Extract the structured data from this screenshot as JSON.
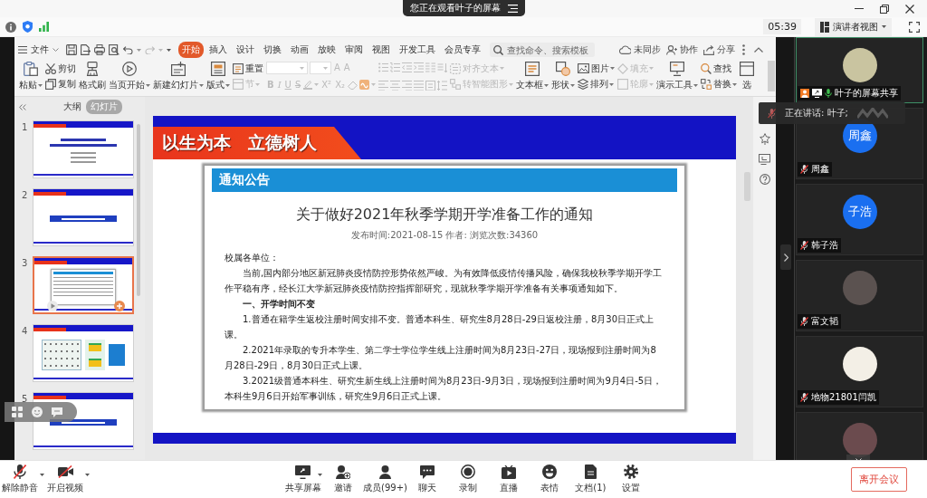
{
  "viewing_banner": {
    "text": "您正在观看叶子的屏幕"
  },
  "top_bar": {
    "timer": "05:39",
    "view_mode": "演讲者视图"
  },
  "ribbon": {
    "file_menu": "文件",
    "tabs": [
      {
        "label": "开始",
        "selected": true
      },
      {
        "label": "插入",
        "selected": false
      },
      {
        "label": "设计",
        "selected": false
      },
      {
        "label": "切换",
        "selected": false
      },
      {
        "label": "动画",
        "selected": false
      },
      {
        "label": "放映",
        "selected": false
      },
      {
        "label": "审阅",
        "selected": false
      },
      {
        "label": "视图",
        "selected": false
      },
      {
        "label": "开发工具",
        "selected": false
      },
      {
        "label": "会员专享",
        "selected": false
      }
    ],
    "search": {
      "placeholder": "查找命令、搜索模板"
    },
    "actions": [
      {
        "label": "未同步"
      },
      {
        "label": "协作"
      },
      {
        "label": "分享"
      }
    ],
    "groups": [
      {
        "kind": "large",
        "label": "粘贴",
        "dropdown": true,
        "disabled": false
      },
      {
        "kind": "stack",
        "items": [
          {
            "label": "剪切",
            "dropdown": false,
            "disabled": false
          },
          {
            "label": "复制",
            "dropdown": false,
            "disabled": false
          }
        ]
      },
      {
        "kind": "large",
        "label": "格式刷",
        "dropdown": false,
        "disabled": false
      },
      {
        "kind": "large",
        "label": "当页开始",
        "dropdown": true,
        "disabled": false
      },
      {
        "kind": "large",
        "label": "新建幻灯片",
        "dropdown": true,
        "disabled": false
      },
      {
        "kind": "large",
        "label": "版式",
        "dropdown": true,
        "disabled": false
      },
      {
        "kind": "stack",
        "items": [
          {
            "label": "重置",
            "dropdown": false,
            "disabled": false
          },
          {
            "label": "节",
            "dropdown": true,
            "disabled": true
          }
        ]
      },
      {
        "kind": "font",
        "disabled": true,
        "size_buttons": [
          "A",
          "A"
        ],
        "format_buttons": [
          "B",
          "I",
          "U",
          "S",
          "X²",
          "X₂"
        ]
      },
      {
        "kind": "paragraph",
        "disabled": true
      },
      {
        "kind": "stack",
        "items": [
          {
            "label": "对齐文本",
            "dropdown": true,
            "disabled": true
          },
          {
            "label": "转智能图形",
            "dropdown": true,
            "disabled": true
          }
        ]
      },
      {
        "kind": "large",
        "label": "文本框",
        "dropdown": true,
        "disabled": false
      },
      {
        "kind": "large",
        "label": "形状",
        "dropdown": true,
        "disabled": false
      },
      {
        "kind": "stack",
        "items": [
          {
            "label": "图片",
            "dropdown": true,
            "disabled": false
          },
          {
            "label": "排列",
            "dropdown": true,
            "disabled": false
          }
        ]
      },
      {
        "kind": "stack",
        "items": [
          {
            "label": "填充",
            "dropdown": true,
            "disabled": true
          },
          {
            "label": "轮廓",
            "dropdown": true,
            "disabled": true
          }
        ]
      },
      {
        "kind": "large",
        "label": "演示工具",
        "dropdown": true,
        "disabled": false
      },
      {
        "kind": "stack",
        "items": [
          {
            "label": "查找",
            "dropdown": false,
            "disabled": false
          },
          {
            "label": "替换",
            "dropdown": true,
            "disabled": false
          }
        ]
      },
      {
        "kind": "large",
        "label": "选",
        "dropdown": false,
        "disabled": false
      }
    ]
  },
  "slide_panel": {
    "tabs": [
      {
        "label": "大纲",
        "selected": false
      },
      {
        "label": "幻灯片",
        "selected": true
      }
    ],
    "slides": [
      {
        "number": "1",
        "kind": "title",
        "selected": false
      },
      {
        "number": "2",
        "kind": "section",
        "selected": false
      },
      {
        "number": "3",
        "kind": "notice",
        "selected": true
      },
      {
        "number": "4",
        "kind": "calendar",
        "selected": false
      },
      {
        "number": "5",
        "kind": "section",
        "selected": false
      }
    ]
  },
  "slide": {
    "banner": "以生为本　立德树人",
    "notice": {
      "header": "通知公告",
      "title": "关于做好2021年秋季学期开学准备工作的通知",
      "meta": "发布时间:2021-08-15 作者: 浏览次数:34360",
      "body": [
        {
          "kind": "plain",
          "text": "校属各单位："
        },
        {
          "kind": "indent",
          "text": "当前,国内部分地区新冠肺炎疫情防控形势依然严峻。为有效降低疫情传播风险，确保我校秋季学期开学工作平稳有序，经长江大学新冠肺炎疫情防控指挥部研究，现就秋季学期开学准备有关事项通知如下。"
        },
        {
          "kind": "heading",
          "text": "一、开学时间不变"
        },
        {
          "kind": "indent",
          "text": "1.普通在籍学生返校注册时间安排不变。普通本科生、研究生8月28日-29日返校注册，8月30日正式上课。"
        },
        {
          "kind": "indent",
          "text": "2.2021年录取的专升本学生、第二学士学位学生线上注册时间为8月23日-27日，现场报到注册时间为8月28日-29日，8月30日正式上课。"
        },
        {
          "kind": "indent",
          "text": "3.2021级普通本科生、研究生新生线上注册时间为8月23日-9月3日，现场报到注册时间为9月4日-5日，本科生9月6日开始军事训练，研究生9月6日正式上课。"
        }
      ]
    }
  },
  "speaking_tooltip": {
    "text": "正在讲话: 叶子;"
  },
  "participants": [
    {
      "kind": "photo",
      "name": "叶子的屏幕共享",
      "speaking": true,
      "host": true,
      "sharing": true,
      "muted": false
    },
    {
      "kind": "initials",
      "initials": "周鑫",
      "name": "周鑫",
      "speaking": false,
      "host": false,
      "sharing": false,
      "muted": true
    },
    {
      "kind": "initials",
      "initials": "子浩",
      "name": "韩子浩",
      "speaking": false,
      "host": false,
      "sharing": false,
      "muted": true
    },
    {
      "kind": "photo",
      "name": "富文韬",
      "speaking": false,
      "host": false,
      "sharing": false,
      "muted": true
    },
    {
      "kind": "photo",
      "name": "地物21801闫凯",
      "speaking": false,
      "host": false,
      "sharing": false,
      "muted": true
    },
    {
      "kind": "photo",
      "speaking": false
    }
  ],
  "toolbar": {
    "media": [
      {
        "label": "解除静音",
        "dropdown": true,
        "off": true
      },
      {
        "label": "开启视频",
        "dropdown": true,
        "off": true
      }
    ],
    "buttons": [
      {
        "label": "共享屏幕",
        "dropdown": true
      },
      {
        "label": "邀请",
        "dropdown": false
      },
      {
        "label": "成员(99+)",
        "dropdown": false
      },
      {
        "label": "聊天",
        "dropdown": false
      },
      {
        "label": "录制",
        "dropdown": false
      },
      {
        "label": "直播",
        "dropdown": false
      },
      {
        "label": "表情",
        "dropdown": false
      },
      {
        "label": "文档(1)",
        "dropdown": false
      },
      {
        "label": "设置",
        "dropdown": false
      }
    ],
    "leave": "离开会议"
  }
}
